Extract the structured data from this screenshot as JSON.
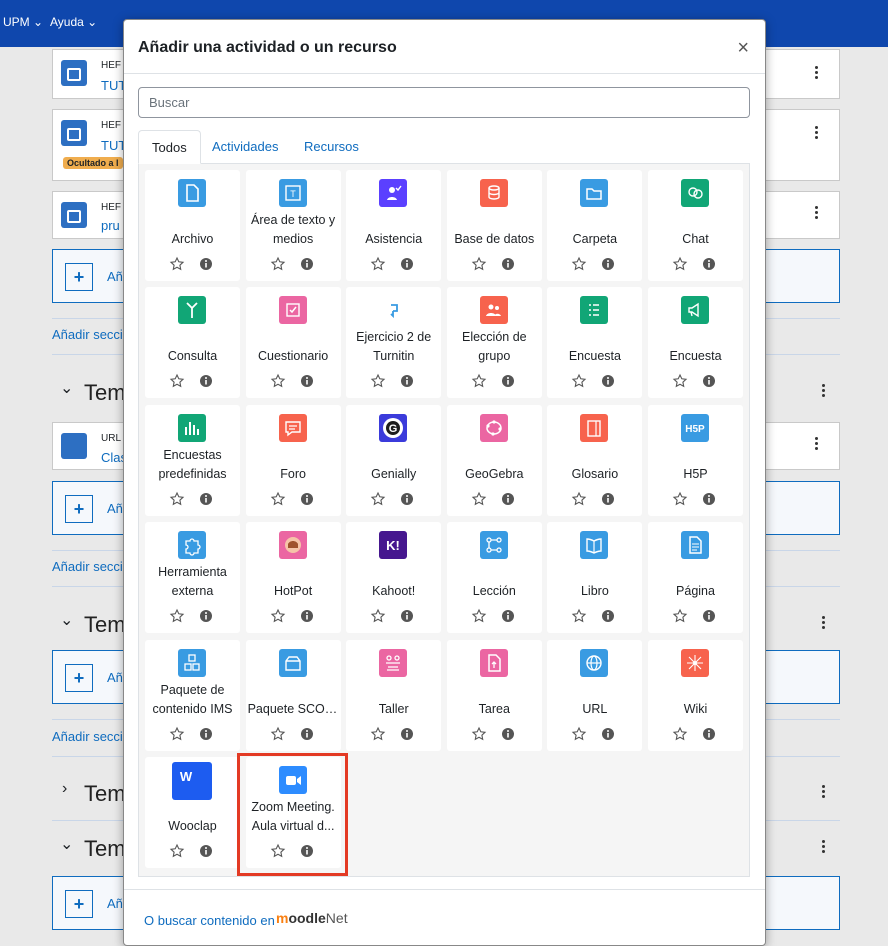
{
  "topnav": {
    "upm": "UPM ⌄",
    "ayuda": "Ayuda ⌄"
  },
  "background": {
    "card_prefix": "HEF",
    "card_sub_1": "TUT",
    "card_sub_2": "TUT",
    "card_sub_3": "pru",
    "hidden_badge": "Ocultado a l",
    "url_prefix": "URL",
    "url_sub": "Clas",
    "add_short": "Añ",
    "add_section": "Añadir secci",
    "topic_short": "Tem",
    "plus": "+"
  },
  "modal": {
    "title": "Añadir una actividad o un recurso",
    "close": "×",
    "search_placeholder": "Buscar",
    "tabs": [
      "Todos",
      "Actividades",
      "Recursos"
    ],
    "footer_link": "O buscar contenido en",
    "footer_logo_m": "m",
    "footer_logo_oodle": "oodle",
    "footer_logo_net": "Net"
  },
  "items": [
    {
      "name": "Archivo",
      "icon": "file-icon",
      "color": "#399be2"
    },
    {
      "name": "Área de texto y medios",
      "icon": "text-media-icon",
      "color": "#399be2"
    },
    {
      "name": "Asistencia",
      "icon": "attendance-icon",
      "color": "#5b40ff"
    },
    {
      "name": "Base de datos",
      "icon": "database-icon",
      "color": "#f7634d"
    },
    {
      "name": "Carpeta",
      "icon": "folder-icon",
      "color": "#399be2"
    },
    {
      "name": "Chat",
      "icon": "chat-icon",
      "color": "#11a676"
    },
    {
      "name": "Consulta",
      "icon": "choice-icon",
      "color": "#11a676"
    },
    {
      "name": "Cuestionario",
      "icon": "quiz-icon",
      "color": "#eb66a2"
    },
    {
      "name": "Ejercicio 2 de Turnitin",
      "icon": "turnitin-icon",
      "color": "#ffffff"
    },
    {
      "name": "Elección de grupo",
      "icon": "group-choice-icon",
      "color": "#f7634d"
    },
    {
      "name": "Encuesta",
      "icon": "feedback-icon",
      "color": "#11a676"
    },
    {
      "name": "Encuesta",
      "icon": "survey-megaphone-icon",
      "color": "#11a676"
    },
    {
      "name": "Encuestas predefinidas",
      "icon": "predefined-survey-icon",
      "color": "#11a676"
    },
    {
      "name": "Foro",
      "icon": "forum-icon",
      "color": "#f7634d"
    },
    {
      "name": "Genially",
      "icon": "genially-icon",
      "color": "#3b3bdb"
    },
    {
      "name": "GeoGebra",
      "icon": "geogebra-icon",
      "color": "#eb66a2"
    },
    {
      "name": "Glosario",
      "icon": "glossary-icon",
      "color": "#f7634d"
    },
    {
      "name": "H5P",
      "icon": "h5p-icon",
      "color": "#399be2"
    },
    {
      "name": "Herramienta externa",
      "icon": "puzzle-icon",
      "color": "#399be2"
    },
    {
      "name": "HotPot",
      "icon": "hotpot-icon",
      "color": "#eb66a2"
    },
    {
      "name": "Kahoot!",
      "icon": "kahoot-icon",
      "color": "#46178f"
    },
    {
      "name": "Lección",
      "icon": "lesson-icon",
      "color": "#399be2"
    },
    {
      "name": "Libro",
      "icon": "book-icon",
      "color": "#399be2"
    },
    {
      "name": "Página",
      "icon": "page-icon",
      "color": "#399be2"
    },
    {
      "name": "Paquete de contenido IMS",
      "icon": "ims-package-icon",
      "color": "#399be2"
    },
    {
      "name": "Paquete SCORM",
      "icon": "scorm-package-icon",
      "color": "#399be2"
    },
    {
      "name": "Taller",
      "icon": "workshop-icon",
      "color": "#eb66a2"
    },
    {
      "name": "Tarea",
      "icon": "assignment-icon",
      "color": "#eb66a2"
    },
    {
      "name": "URL",
      "icon": "url-globe-icon",
      "color": "#399be2"
    },
    {
      "name": "Wiki",
      "icon": "wiki-icon",
      "color": "#f7634d"
    },
    {
      "name": "Wooclap",
      "icon": "wooclap-icon",
      "color": "#1d5cf0"
    },
    {
      "name": "Zoom Meeting. Aula virtual d...",
      "icon": "zoom-icon",
      "color": "#2d8cff"
    }
  ]
}
